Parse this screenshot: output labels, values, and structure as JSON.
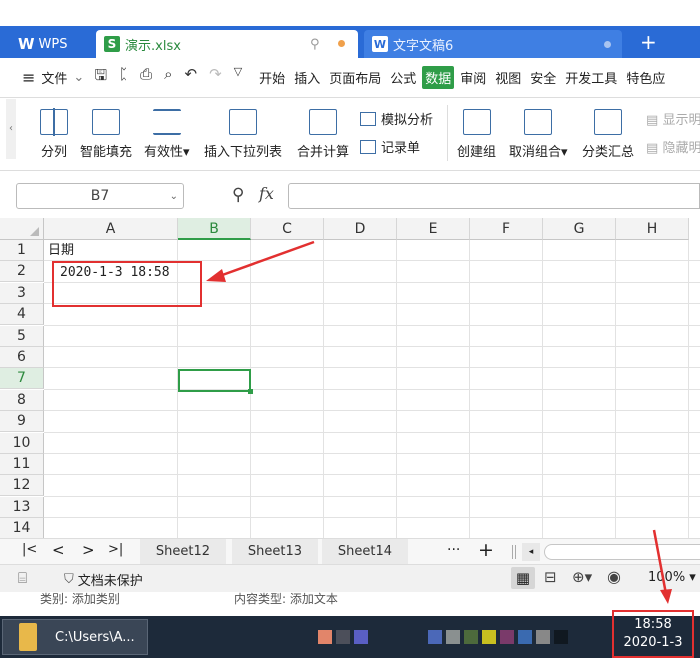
{
  "tabs": {
    "wps": "WPS",
    "xlsx": "演示.xlsx",
    "doc": "文字文稿6",
    "add": "+"
  },
  "menu": {
    "file": "文件",
    "items": [
      "开始",
      "插入",
      "页面布局",
      "公式",
      "数据",
      "审阅",
      "视图",
      "安全",
      "开发工具",
      "特色应"
    ],
    "active_index": 4
  },
  "ribbon": {
    "fenlie": "分列",
    "zhinengtianchong": "智能填充",
    "youxiaoxing": "有效性",
    "chaxiala": "插入下拉列表",
    "hebingjisuan": "合并计算",
    "moni": "模拟分析",
    "jilu": "记录单",
    "chuangjianzu": "创建组",
    "quxiaozuhe": "取消组合",
    "fenlei": "分类汇总",
    "xianshi": "显示明",
    "yincang": "隐藏明"
  },
  "formula_bar": {
    "cell_ref": "B7",
    "fx": "fx"
  },
  "sheet": {
    "columns": [
      "A",
      "B",
      "C",
      "D",
      "E",
      "F",
      "G",
      "H"
    ],
    "rows": [
      "1",
      "2",
      "3",
      "4",
      "5",
      "6",
      "7",
      "8",
      "9",
      "10",
      "11",
      "12",
      "13",
      "14"
    ],
    "selected_col": "B",
    "selected_row": "7",
    "a1": "日期",
    "a2": "2020-1-3 18:58"
  },
  "sheet_tabs": [
    "Sheet12",
    "Sheet13",
    "Sheet14"
  ],
  "status": {
    "protect": "文档未保护",
    "zoom": "100% ▾"
  },
  "props": {
    "category": "类别: 添加类别",
    "content_type": "内容类型: 添加文本"
  },
  "taskbar": {
    "folder_path": "C:\\Users\\A...",
    "time": "18:58",
    "date": "2020-1-3"
  },
  "colors": {
    "accent_green": "#2f9d48",
    "tab_blue": "#2a6bd6",
    "annotation_red": "#e23030"
  }
}
